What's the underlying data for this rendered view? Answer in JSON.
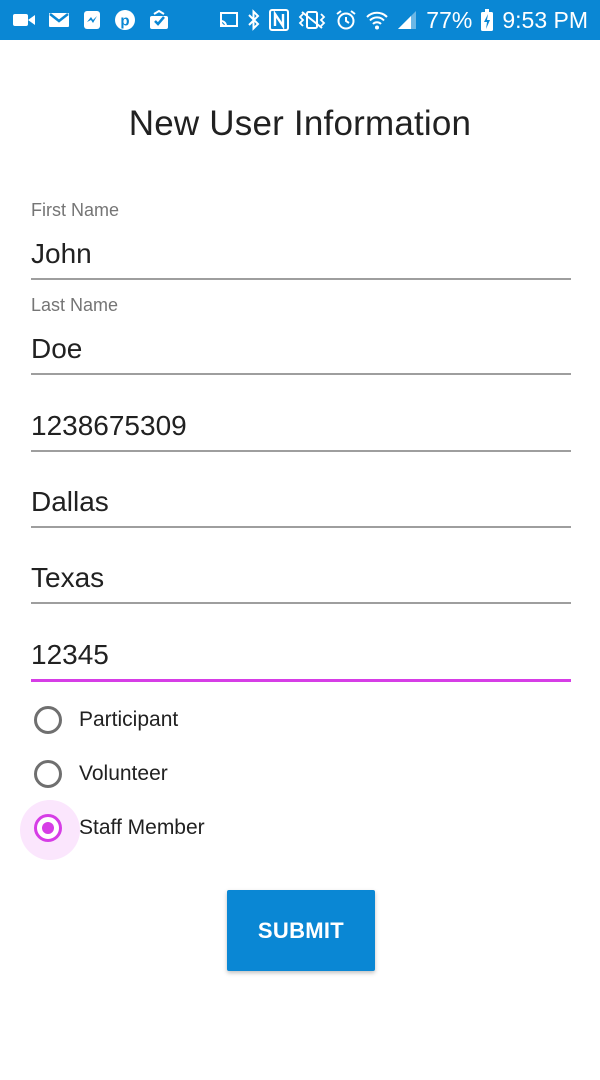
{
  "status_bar": {
    "left_icons": [
      "video-camera-icon",
      "gmail-icon",
      "messenger-icon",
      "pinterest-icon",
      "inbox-icon"
    ],
    "right_icons": [
      "cast-icon",
      "bluetooth-icon",
      "nfc-icon",
      "vibrate-icon",
      "alarm-icon",
      "wifi-icon",
      "signal-icon"
    ],
    "battery_percent": "77%",
    "battery_icon": "battery-charging-icon",
    "time": "9:53 PM",
    "background_color": "#0a87d4"
  },
  "form": {
    "title": "New User Information",
    "first_name": {
      "label": "First Name",
      "value": "John"
    },
    "last_name": {
      "label": "Last Name",
      "value": "Doe"
    },
    "phone": {
      "value": "1238675309"
    },
    "city": {
      "value": "Dallas"
    },
    "state": {
      "value": "Texas"
    },
    "zip": {
      "value": "12345",
      "focused": true
    },
    "role_options": [
      {
        "label": "Participant",
        "checked": false
      },
      {
        "label": "Volunteer",
        "checked": false
      },
      {
        "label": "Staff Member",
        "checked": true
      }
    ],
    "submit_label": "SUBMIT"
  },
  "colors": {
    "accent": "#d63de6",
    "primary": "#0a87d4"
  }
}
